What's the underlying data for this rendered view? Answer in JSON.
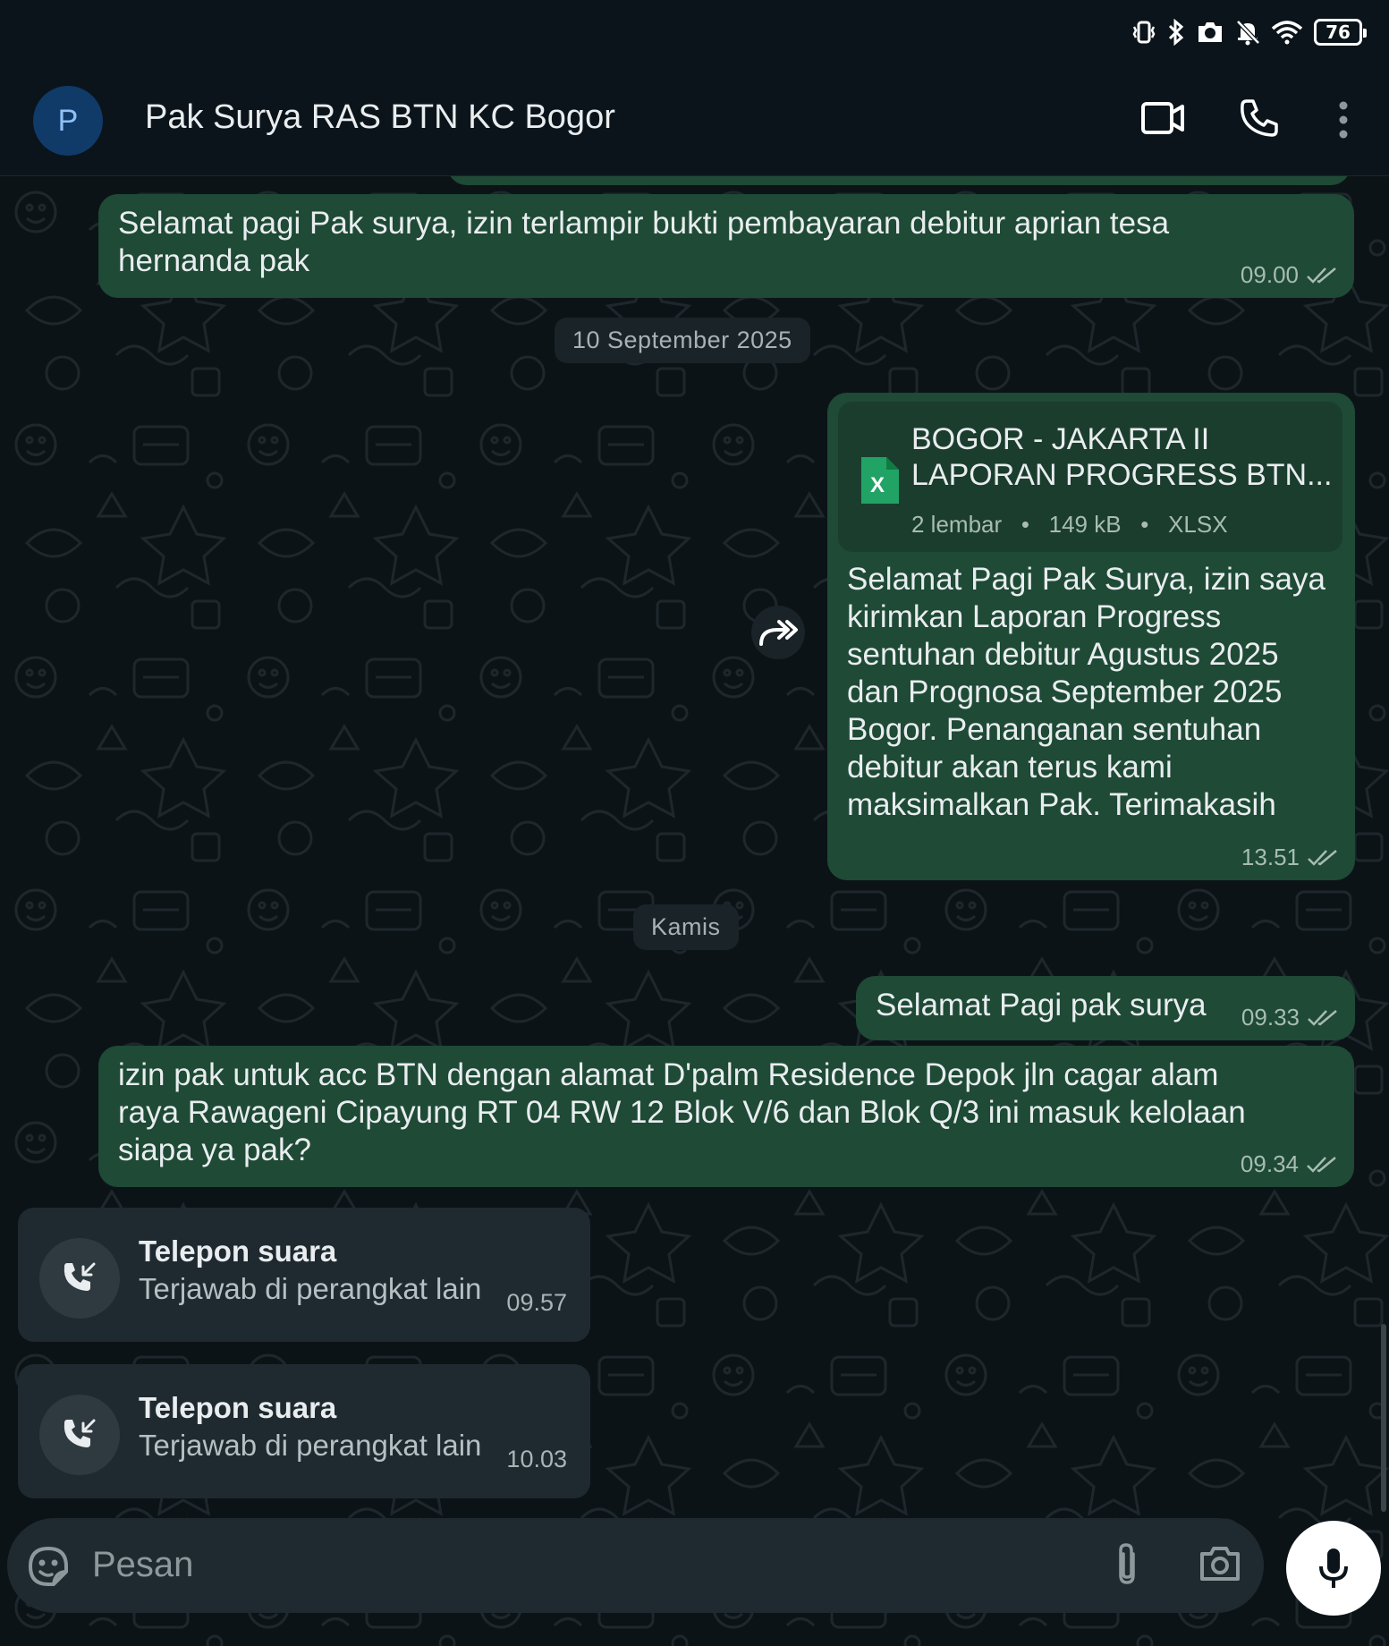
{
  "status_bar": {
    "battery": "76",
    "icons": [
      "vibrate-icon",
      "bluetooth-icon",
      "camera-icon",
      "mute-icon",
      "wifi-icon",
      "battery-icon"
    ]
  },
  "header": {
    "avatar_letter": "P",
    "contact_name": "Pak Surya RAS BTN KC Bogor",
    "icons": [
      "video-call-icon",
      "phone-icon",
      "more-icon"
    ]
  },
  "messages": [
    {
      "type": "text",
      "direction": "out",
      "text": "Selamat pagi Pak surya, izin terlampir bukti pembayaran debitur aprian tesa hernanda pak",
      "time": "09.00",
      "status": "read"
    },
    {
      "type": "date",
      "text": "10 September 2025"
    },
    {
      "type": "document",
      "direction": "out",
      "doc_line1": "BOGOR - JAKARTA II",
      "doc_line2": "LAPORAN PROGRESS BTN...",
      "doc_pages": "2 lembar",
      "doc_size": "149 kB",
      "doc_ext": "XLSX",
      "doc_icon_letter": "X",
      "caption": "Selamat Pagi Pak Surya, izin saya kirimkan Laporan Progress sentuhan debitur Agustus 2025 dan Prognosa September 2025 Bogor. Penanganan sentuhan debitur akan terus kami maksimalkan Pak. Terimakasih",
      "time": "13.51",
      "status": "read"
    },
    {
      "type": "date",
      "text": "Kamis"
    },
    {
      "type": "text",
      "direction": "out",
      "text": "Selamat Pagi pak surya",
      "time": "09.33",
      "status": "read"
    },
    {
      "type": "text",
      "direction": "out",
      "text": "izin pak untuk acc BTN dengan alamat D'palm Residence Depok jln cagar alam raya Rawageni Cipayung RT 04 RW 12 Blok V/6 dan Blok Q/3 ini masuk kelolaan siapa ya pak?",
      "time": "09.34",
      "status": "read"
    },
    {
      "type": "call",
      "direction": "in",
      "title": "Telepon suara",
      "status": "Terjawab di perangkat lain",
      "time": "09.57"
    },
    {
      "type": "call",
      "direction": "in",
      "title": "Telepon suara",
      "status": "Terjawab di perangkat lain",
      "time": "10.03"
    }
  ],
  "input": {
    "placeholder": "Pesan",
    "icons": [
      "sticker-icon",
      "attach-icon",
      "camera-icon",
      "mic-icon"
    ]
  },
  "colors": {
    "background": "#0b141a",
    "outgoing_bubble": "#1e4a36",
    "incoming_bubble": "#1f2a30",
    "read_tick": "#a8bcb2",
    "excel_green": "#21a366"
  }
}
